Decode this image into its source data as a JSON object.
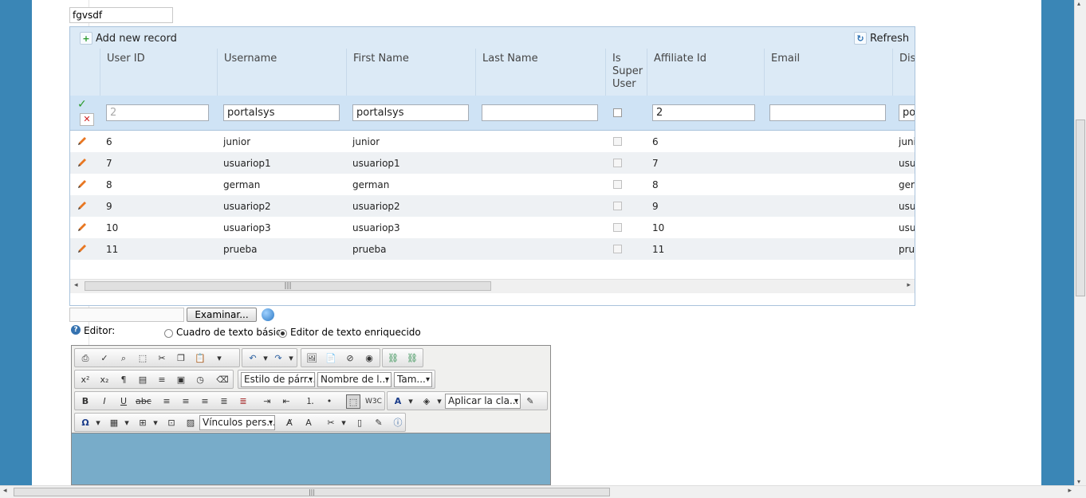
{
  "top_input_value": "fgvsdf",
  "grid": {
    "add_label": "Add new record",
    "refresh_label": "Refresh",
    "columns": [
      "User ID",
      "Username",
      "First Name",
      "Last Name",
      "Is Super User",
      "Affiliate Id",
      "Email",
      "Dis"
    ],
    "column_is_super": [
      "Is",
      "Super",
      "User"
    ],
    "edit_row": {
      "user_id": "2",
      "username": "portalsys",
      "first_name": "portalsys",
      "last_name": "",
      "affiliate_id": "2",
      "email": "",
      "display": "por"
    },
    "rows": [
      {
        "id": "6",
        "username": "junior",
        "first": "junior",
        "affiliate": "6",
        "display": "juni"
      },
      {
        "id": "7",
        "username": "usuariop1",
        "first": "usuariop1",
        "affiliate": "7",
        "display": "usu"
      },
      {
        "id": "8",
        "username": "german",
        "first": "german",
        "affiliate": "8",
        "display": "gerr"
      },
      {
        "id": "9",
        "username": "usuariop2",
        "first": "usuariop2",
        "affiliate": "9",
        "display": "usu"
      },
      {
        "id": "10",
        "username": "usuariop3",
        "first": "usuariop3",
        "affiliate": "10",
        "display": "usu"
      },
      {
        "id": "11",
        "username": "prueba",
        "first": "prueba",
        "affiliate": "11",
        "display": "pru"
      }
    ]
  },
  "upload": {
    "browse_label": "Examinar..."
  },
  "editor_choice": {
    "label": "Editor:",
    "basic": "Cuadro de texto básico",
    "rich": "Editor de texto enriquecido"
  },
  "toolbar": {
    "format_select": "Estilo de párr...",
    "font_select": "Nombre de l...",
    "size_select": "Tam...",
    "class_select": "Aplicar la cla...",
    "links_select": "Vínculos pers..."
  },
  "colors": {
    "background": "#3a86b6",
    "grid_header": "#dceaf6",
    "edit_area": "#78acc9"
  }
}
